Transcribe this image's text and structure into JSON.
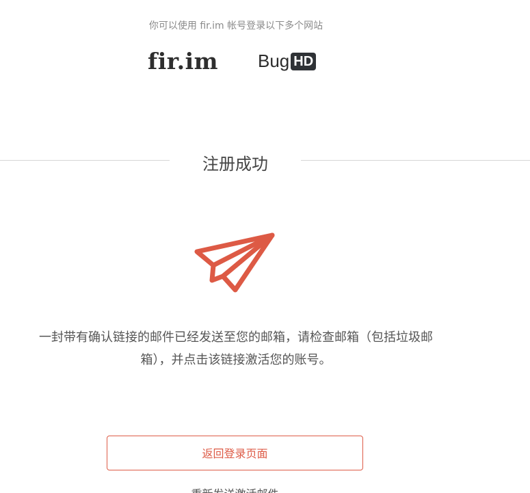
{
  "header": {
    "hint": "你可以使用 fir.im 帐号登录以下多个网站",
    "logos": {
      "fir": "fir.im",
      "bughd_prefix": "Bug",
      "bughd_suffix": "HD"
    }
  },
  "main": {
    "title": "注册成功",
    "icon": "paper-plane-icon",
    "message": "一封带有确认链接的邮件已经发送至您的邮箱，请检查邮箱（包括垃圾邮箱），并点击该链接激活您的账号。",
    "back_button": "返回登录页面",
    "resend_link": "重新发送激活邮件"
  },
  "colors": {
    "accent": "#dd5a45",
    "text": "#555555",
    "muted": "#8a8a8a",
    "divider": "#d5d5d5"
  }
}
